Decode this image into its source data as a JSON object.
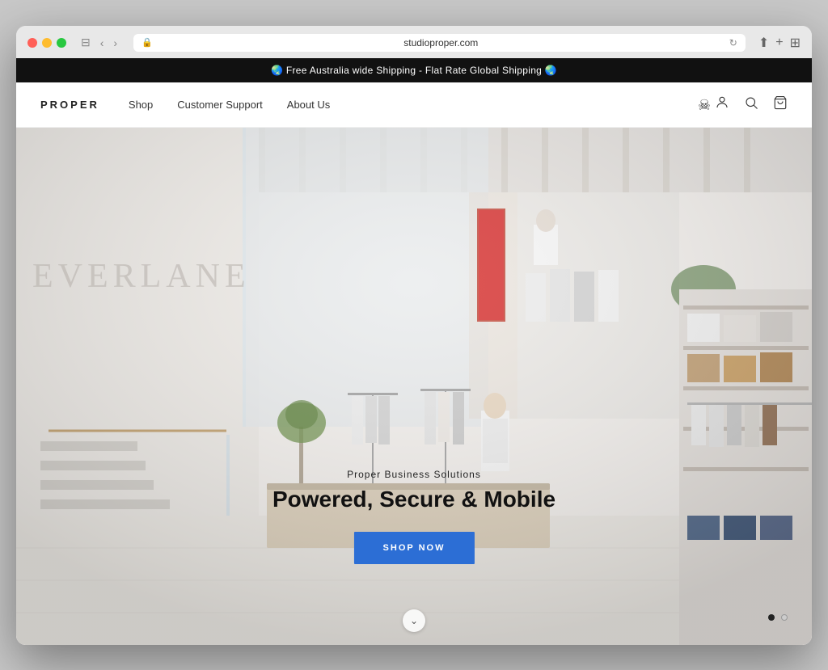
{
  "browser": {
    "url": "studioproper.com",
    "back_label": "‹",
    "forward_label": "›",
    "sidebar_label": "⊞",
    "share_label": "⬆",
    "add_tab_label": "+",
    "grid_label": "⊞"
  },
  "announcement": {
    "text": "🌏 Free Australia wide Shipping - Flat Rate Global Shipping 🌏"
  },
  "nav": {
    "logo": "PROPER",
    "links": [
      {
        "label": "Shop"
      },
      {
        "label": "Customer Support"
      },
      {
        "label": "About Us"
      }
    ]
  },
  "hero": {
    "everlane_text": "EVERLANE",
    "subtitle": "Proper Business Solutions",
    "title": "Powered, Secure & Mobile",
    "cta_label": "SHOP NOW"
  },
  "dots": [
    {
      "active": true
    },
    {
      "active": false
    }
  ],
  "scroll": {
    "arrow": "⌄"
  }
}
